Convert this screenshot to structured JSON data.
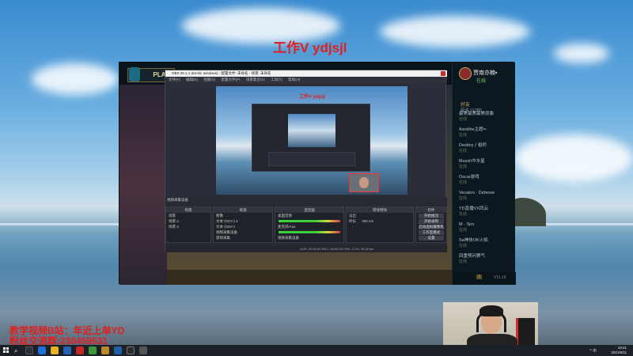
{
  "overlay": {
    "top_text": "工作V ydjsjl",
    "bottom_line1": "教学视频B站：年近上单YD",
    "bottom_line2": "粉丝交流群:230459531"
  },
  "client": {
    "play_label": "PLAY",
    "profile_name": "贾南亦楠▪",
    "profile_status": "在线",
    "friends_heading": "好友",
    "friends_group": "综合 (1/39)",
    "friends": [
      {
        "name": "最美最美最美就像",
        "status": "在线"
      },
      {
        "name": "Asnklhe主题=-",
        "status": "在线"
      },
      {
        "name": "Destiny丿祖师",
        "status": "在线"
      },
      {
        "name": "Mussh中水星",
        "status": "在线"
      },
      {
        "name": "Oscar游戏",
        "status": "在线"
      },
      {
        "name": "Vecakro · Defense",
        "status": "在线"
      },
      {
        "name": "YD直播VX同云",
        "status": "在线"
      },
      {
        "name": "M · Siro",
        "status": "在线"
      },
      {
        "name": "Sa神技OK火焰",
        "status": "在线"
      },
      {
        "name": "四重预问赛气",
        "status": "在线"
      }
    ],
    "footer_count": "3",
    "footer_version": "V11.15"
  },
  "obs": {
    "title": "OBS 26.1.1 (64-bit, windows) - 配置文件: 未命名 - 场景: 未命名",
    "menu": [
      "文件(F)",
      "编辑(E)",
      "视图(V)",
      "配置文件(P)",
      "场景集合(S)",
      "工具(T)",
      "帮助(H)"
    ],
    "preview_overlay": "工作V ydjsjl",
    "dock_label": "视频采集设备",
    "scenes_header": "场景",
    "scenes": [
      "场景",
      "场景 2",
      "场景 3"
    ],
    "sources_header": "来源",
    "sources": [
      "图像",
      "文本 (GDI+) 2",
      "文本 (GDI+)",
      "视频采集设备",
      "游戏采集",
      "显示器采集"
    ],
    "mixer_header": "混音器",
    "mixer_tracks": [
      "桌面音频",
      "麦克风/Aux",
      "视频采集设备"
    ],
    "transitions_header": "转场特效",
    "transition_value": "淡出",
    "transition_duration_label": "时长",
    "transition_duration": "300 ms",
    "controls_header": "控件",
    "controls": [
      "开始推流",
      "开始录制",
      "启动虚拟摄像机",
      "工作室模式",
      "设置",
      "退出"
    ],
    "status": "LIVE: 00:00:00  REC: 00:00:00  CPU: 2.1%, 30.00 fps"
  },
  "taskbar": {
    "clock_time": "19:21",
    "clock_date": "2021/6/11",
    "tray_text": "^ 中"
  },
  "colors": {
    "overlay_red": "#e02020",
    "obs_bg": "#2b2e38",
    "client_bg": "#0d1a22",
    "taskbar_bg": "#1c2128"
  }
}
